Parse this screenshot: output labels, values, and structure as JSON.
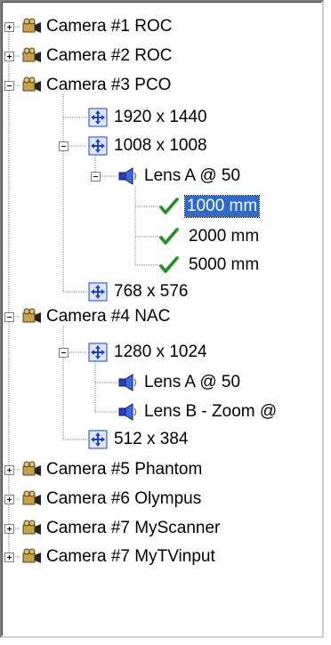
{
  "tree": {
    "cam1": {
      "label": "Camera #1 ROC"
    },
    "cam2": {
      "label": "Camera #2 ROC"
    },
    "cam3": {
      "label": "Camera #3 PCO",
      "res1": {
        "label": "1920 x 1440"
      },
      "res2": {
        "label": "1008 x 1008",
        "lens": {
          "label": "Lens A @ 50",
          "d1": {
            "label": "1000 mm"
          },
          "d2": {
            "label": "2000 mm"
          },
          "d3": {
            "label": "5000 mm"
          }
        }
      },
      "res3": {
        "label": "768 x 576"
      }
    },
    "cam4": {
      "label": "Camera #4 NAC",
      "res1": {
        "label": "1280 x 1024",
        "lensA": {
          "label": "Lens A @ 50"
        },
        "lensB": {
          "label": "Lens B - Zoom @"
        }
      },
      "res2": {
        "label": "512 x 384"
      }
    },
    "cam5": {
      "label": "Camera #5 Phantom"
    },
    "cam6": {
      "label": "Camera #6 Olympus"
    },
    "cam7a": {
      "label": "Camera #7 MyScanner"
    },
    "cam7b": {
      "label": "Camera #7 MyTVinput"
    }
  },
  "icons": {
    "camera": "camera-icon",
    "resolution": "move-arrows-icon",
    "lens": "lens-icon",
    "distance": "checkmark-icon"
  },
  "colors": {
    "selection": "#316ac5",
    "resolution_icon": "#1a3fd6",
    "check": "#3aa53a",
    "camera_icon": "#8a6a2a"
  }
}
